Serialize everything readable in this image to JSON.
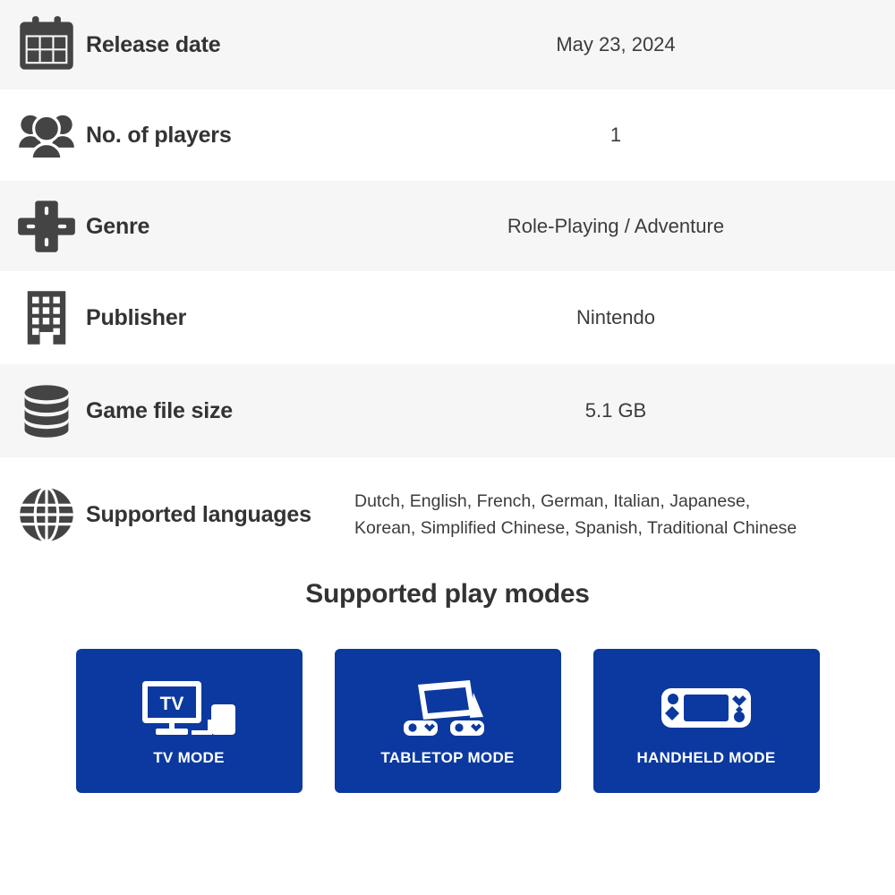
{
  "spec_rows": [
    {
      "icon": "calendar-icon",
      "label": "Release date",
      "value": "May 23, 2024",
      "striped": true
    },
    {
      "icon": "players-icon",
      "label": "No. of players",
      "value": "1",
      "striped": false
    },
    {
      "icon": "dpad-icon",
      "label": "Genre",
      "value": "Role-Playing / Adventure",
      "striped": true
    },
    {
      "icon": "building-icon",
      "label": "Publisher",
      "value": "Nintendo",
      "striped": false
    },
    {
      "icon": "database-icon",
      "label": "Game file size",
      "value": "5.1 GB",
      "striped": true
    },
    {
      "icon": "globe-icon",
      "label": "Supported languages",
      "value": "Dutch, English, French, German, Italian, Japanese, Korean, Simplified Chinese, Spanish, Traditional Chinese",
      "value_line1": "Dutch, English, French, German, Italian, Japanese,",
      "value_line2": "Korean, Simplified Chinese, Spanish, Traditional Chinese",
      "striped": false
    }
  ],
  "play_modes": {
    "title": "Supported play modes",
    "card_color": "#0b39a0",
    "cards": [
      {
        "icon": "tv-mode-icon",
        "label": "TV MODE",
        "screen_text": "TV"
      },
      {
        "icon": "tabletop-mode-icon",
        "label": "TABLETOP MODE"
      },
      {
        "icon": "handheld-mode-icon",
        "label": "HANDHELD MODE"
      }
    ]
  },
  "colors": {
    "stripe": "#f6f6f6",
    "text": "#3b3b3b",
    "brand_blue": "#0b39a0"
  }
}
